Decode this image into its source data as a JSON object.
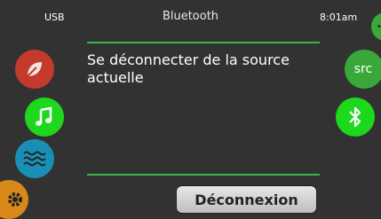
{
  "status_bar": {
    "source_label": "USB",
    "title": "Bluetooth",
    "time": "8:01am"
  },
  "message": "Se déconnecter de la source actuelle",
  "buttons": {
    "disconnect_label": "Déconnexion",
    "src_label": "src"
  },
  "icons": {
    "left": [
      "leaf-icon",
      "music-note-icon",
      "water-waves-icon",
      "gear-icon"
    ],
    "right": [
      "more-icon",
      "src-icon",
      "bluetooth-icon"
    ]
  },
  "colors": {
    "background": "#323232",
    "accent_green": "#39b54a",
    "bright_green": "#1ed81e",
    "source_green": "#3aa838",
    "leaf_red": "#c43a2c",
    "water_blue": "#1a8fb5",
    "gear_orange": "#d9891a"
  }
}
